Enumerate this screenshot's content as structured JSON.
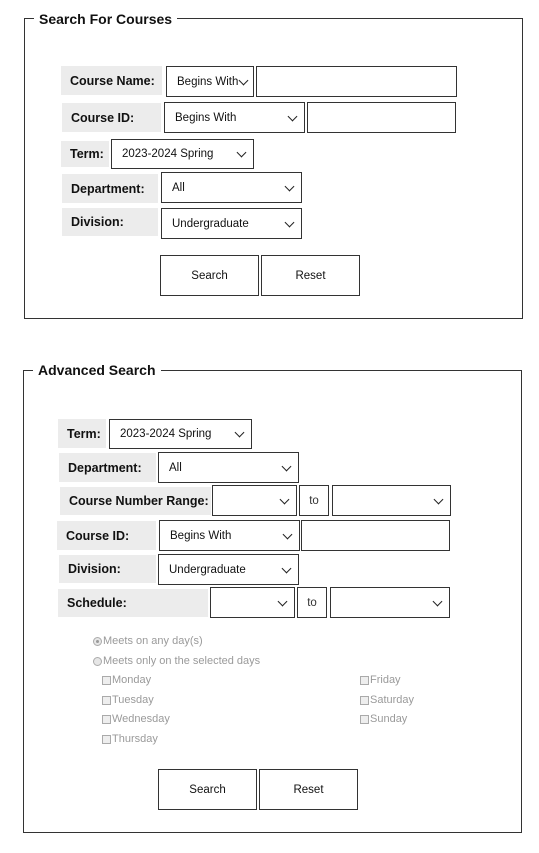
{
  "basic": {
    "legend": "Search For Courses",
    "course_name": {
      "label": "Course Name:",
      "mode": "Begins With",
      "value": ""
    },
    "course_id": {
      "label": "Course ID:",
      "mode": "Begins With",
      "value": ""
    },
    "term": {
      "label": "Term:",
      "value": "2023-2024 Spring"
    },
    "department": {
      "label": "Department:",
      "value": "All"
    },
    "division": {
      "label": "Division:",
      "value": "Undergraduate"
    },
    "search_label": "Search",
    "reset_label": "Reset"
  },
  "advanced": {
    "legend": "Advanced Search",
    "term": {
      "label": "Term:",
      "value": "2023-2024 Spring"
    },
    "department": {
      "label": "Department:",
      "value": "All"
    },
    "course_number_range": {
      "label": "Course Number Range:",
      "from": "",
      "to_label": "to",
      "to": ""
    },
    "course_id": {
      "label": "Course ID:",
      "mode": "Begins With",
      "value": ""
    },
    "division": {
      "label": "Division:",
      "value": "Undergraduate"
    },
    "schedule": {
      "label": "Schedule:",
      "from": "",
      "to_label": "to",
      "to": ""
    },
    "meet_options": {
      "any_days": "Meets on any day(s)",
      "selected_days": "Meets only on the selected days",
      "selected": "any_days"
    },
    "days": {
      "monday": "Monday",
      "tuesday": "Tuesday",
      "wednesday": "Wednesday",
      "thursday": "Thursday",
      "friday": "Friday",
      "saturday": "Saturday",
      "sunday": "Sunday"
    },
    "search_label": "Search",
    "reset_label": "Reset"
  }
}
